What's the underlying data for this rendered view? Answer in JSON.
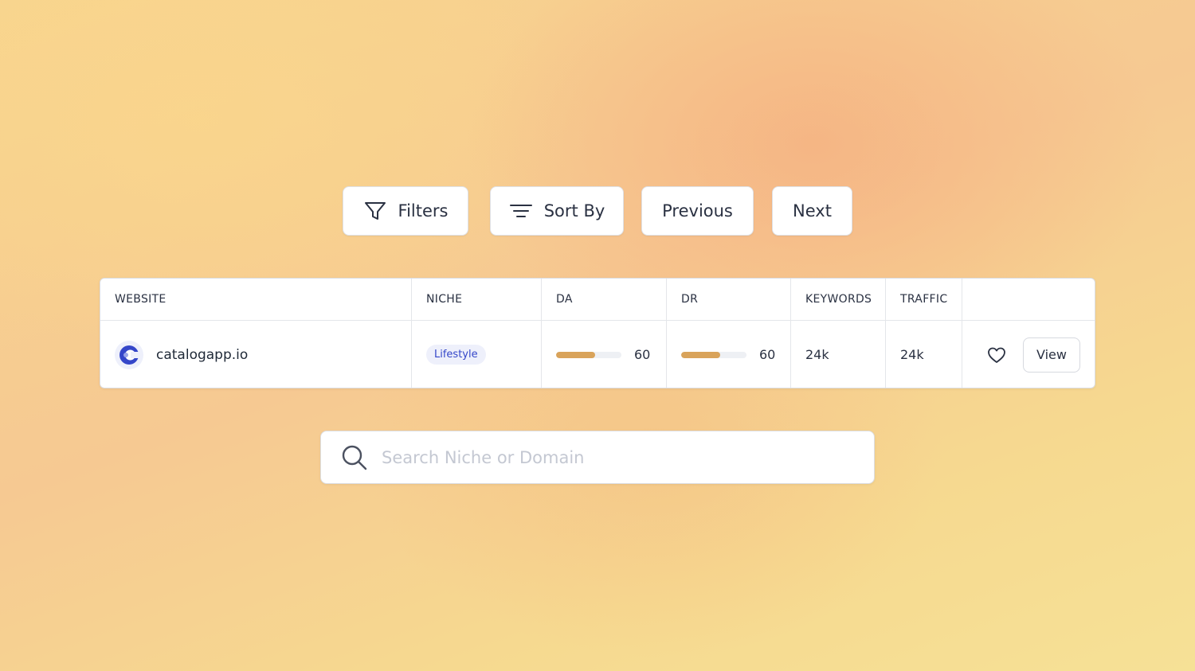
{
  "toolbar": {
    "filters_label": "Filters",
    "sort_label": "Sort By",
    "previous_label": "Previous",
    "next_label": "Next"
  },
  "table": {
    "headers": [
      "WEBSITE",
      "NICHE",
      "DA",
      "DR",
      "KEYWORDS",
      "TRAFFIC",
      ""
    ],
    "rows": [
      {
        "website": "catalogapp.io",
        "niche": "Lifestyle",
        "da": "60",
        "dr": "60",
        "keywords": "24k",
        "traffic": "24k",
        "view_label": "View"
      }
    ]
  },
  "search": {
    "value": "",
    "placeholder": "Search Niche or Domain"
  },
  "colors": {
    "accent": "#3446c9",
    "bar": "#d9a35a"
  }
}
